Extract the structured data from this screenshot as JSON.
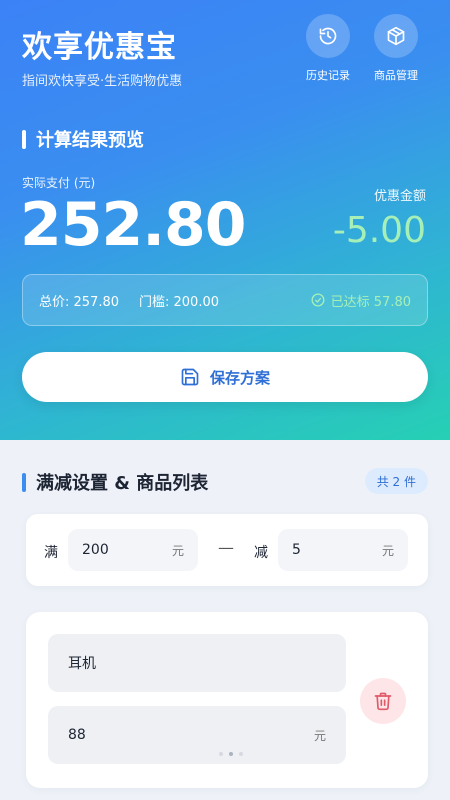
{
  "header": {
    "title": "欢享优惠宝",
    "subtitle": "指间欢快享受·生活购物优惠",
    "history_label": "历史记录",
    "products_label": "商品管理"
  },
  "result": {
    "section_title": "计算结果预览",
    "pay_label": "实际支付 (元)",
    "pay_value": "252.80",
    "discount_label": "优惠金额",
    "discount_value": "-5.00",
    "total_text": "总价: 257.80",
    "threshold_text": "门槛: 200.00",
    "reached_text": "已达标 57.80"
  },
  "save_label": "保存方案",
  "list": {
    "section_title": "满减设置 & 商品列表",
    "count_badge": "共 2 件"
  },
  "rule": {
    "full_label": "满",
    "full_value": "200",
    "full_unit": "元",
    "separator": "—",
    "minus_label": "减",
    "minus_value": "5",
    "minus_unit": "元"
  },
  "product": {
    "name": "耳机",
    "price": "88",
    "unit": "元"
  },
  "colors": {
    "accent": "#3a8ef0",
    "success": "#a6f0b8",
    "danger": "#e05a6a"
  }
}
